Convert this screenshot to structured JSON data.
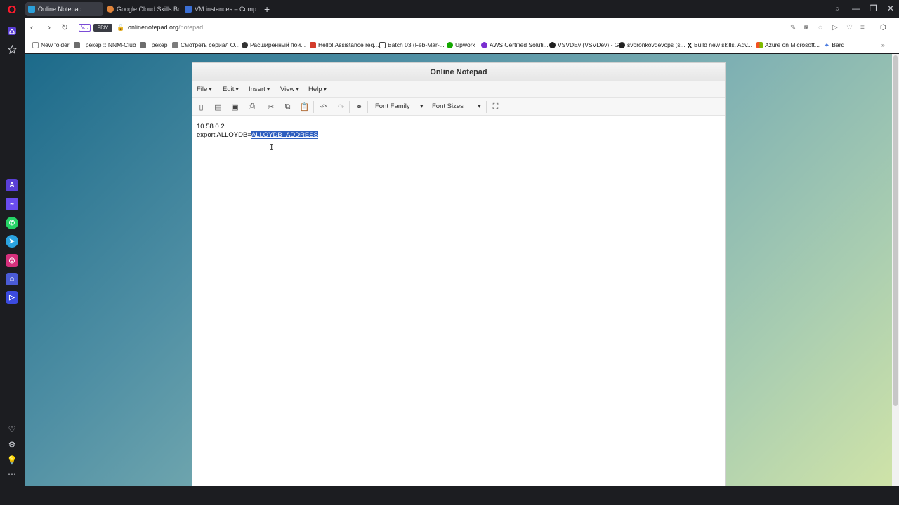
{
  "browser": {
    "tabs": [
      {
        "label": "Online Notepad",
        "active": true,
        "color": "#2b9fd9"
      },
      {
        "label": "Google Cloud Skills Boost",
        "active": false,
        "color": "#e0843a"
      },
      {
        "label": "VM instances – Compute",
        "active": false,
        "color": "#3b6fd4"
      }
    ],
    "new_tab_glyph": "+",
    "badge_v": "V...",
    "badge_priv": "PRIV",
    "url_domain": "onlinenotepad.org",
    "url_path": "/notepad"
  },
  "bookmarks": [
    {
      "label": "New folder",
      "icon_color": "#8a8a8a"
    },
    {
      "label": "Трекер :: NNM-Club",
      "icon_color": "#6d6d6d"
    },
    {
      "label": "Трекер",
      "icon_color": "#6d6d6d"
    },
    {
      "label": "Смотреть сериал О...",
      "icon_color": "#7c7c7c"
    },
    {
      "label": "Расширенный пои...",
      "icon_color": "#333333"
    },
    {
      "label": "Hello! Assistance req...",
      "icon_color": "#d33c2c"
    },
    {
      "label": "Batch 03 (Feb-Mar-...",
      "icon_color": "#444444"
    },
    {
      "label": "Upwork",
      "icon_color": "#14a800"
    },
    {
      "label": "AWS Certified Soluti...",
      "icon_color": "#7a2fd0"
    },
    {
      "label": "VSVDEv (VSVDev) - G...",
      "icon_color": "#222222"
    },
    {
      "label": "svoronkovdevops (s...",
      "icon_color": "#222222"
    },
    {
      "label": "Build new skills. Adv...",
      "icon_color": "#111111"
    },
    {
      "label": "Azure on Microsoft...",
      "icon_color": "#f25022"
    },
    {
      "label": "Bard",
      "icon_color": "#4a7be0"
    }
  ],
  "notepad": {
    "title": "Online Notepad",
    "menus": [
      "File",
      "Edit",
      "Insert",
      "View",
      "Help"
    ],
    "font_family": "Font Family",
    "font_sizes": "Font Sizes",
    "line1": "10.58.0.2",
    "line2_prefix": "export ALLOYDB=",
    "line2_selected": "ALLOYDB_ADDRESS"
  }
}
